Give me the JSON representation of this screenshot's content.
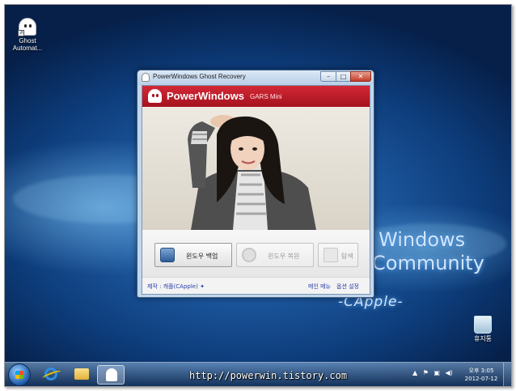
{
  "desktop": {
    "icons": [
      {
        "label": "Ghost Automat..."
      },
      {
        "label": "휴지통"
      }
    ],
    "brand": {
      "line1": "Windows",
      "line2": "Community",
      "line3": "-CApple-"
    }
  },
  "window": {
    "title": "PowerWindows Ghost Recovery",
    "header_name": "PowerWindows",
    "header_sub": "GARS Mini",
    "buttons": {
      "backup": "윈도우 백업",
      "restore": "윈도우 복원",
      "explore": "탐색"
    },
    "footer": {
      "credit": "제작 : 캐플(CApple)  ✦",
      "main_menu": "메인 메뉴",
      "options": "옵션 설정"
    }
  },
  "taskbar": {
    "watermark": "http://powerwin.tistory.com",
    "clock_time": "오후 3:05",
    "clock_date": "2012-07-12"
  }
}
